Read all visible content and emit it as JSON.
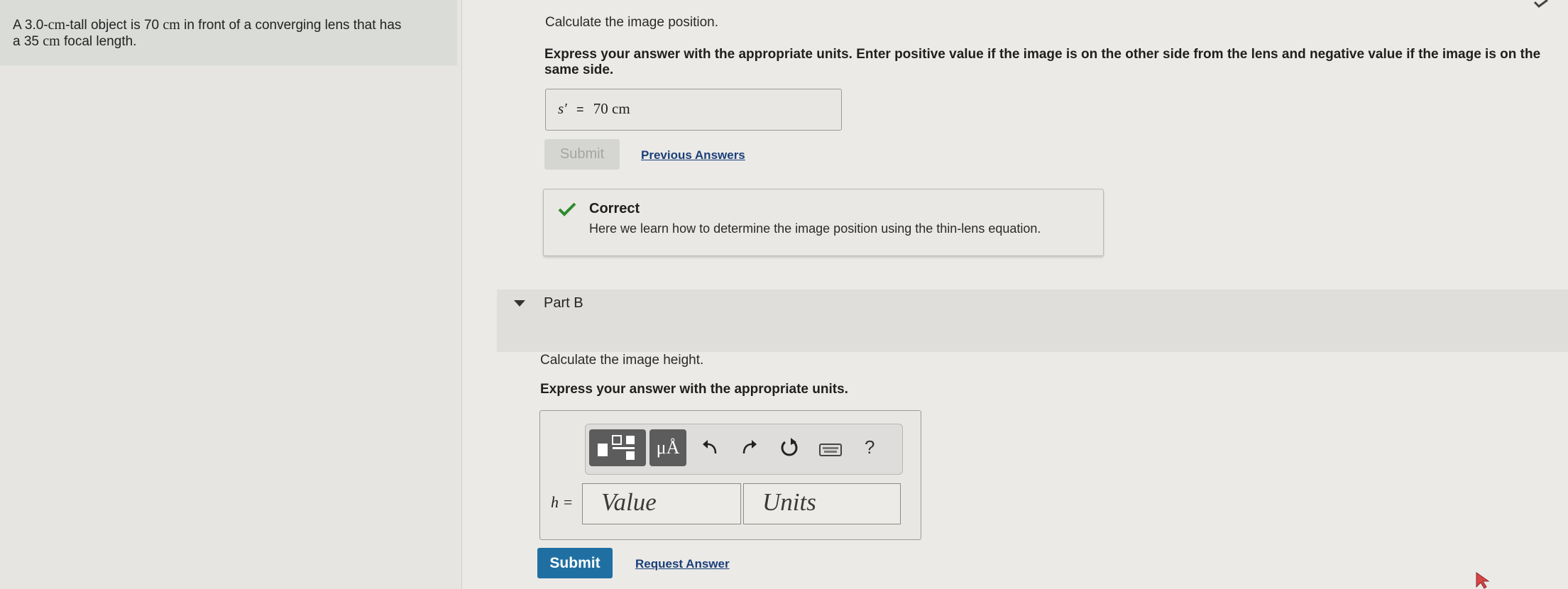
{
  "problem": {
    "line1_a": "A 3.0-",
    "line1_unit1": "cm",
    "line1_b": "-tall object is 70 ",
    "line1_unit2": "cm",
    "line1_c": " in front of a converging lens that has",
    "line2_a": "a 35 ",
    "line2_unit": "cm",
    "line2_b": " focal length."
  },
  "partA": {
    "prompt": "Calculate the image position.",
    "instructions": "Express your answer with the appropriate units. Enter positive value if the image is on the other side from the lens and negative value if the image is on the same side.",
    "answer_var": "s′",
    "answer_eq": "=",
    "answer_value": "70 cm",
    "submit_label": "Submit",
    "previous_answers_label": "Previous Answers",
    "feedback_title": "Correct",
    "feedback_text": "Here we learn how to determine the image position using the thin-lens equation."
  },
  "partB": {
    "title": "Part B",
    "prompt": "Calculate the image height.",
    "instructions": "Express your answer with the appropriate units.",
    "toolbar": {
      "mu_label": "μÅ",
      "help_label": "?"
    },
    "variable_label": "h =",
    "value_placeholder": "Value",
    "units_placeholder": "Units",
    "submit_label": "Submit",
    "request_answer_label": "Request Answer"
  },
  "colors": {
    "accent": "#1f6fa3",
    "correct_green": "#2f8a2f",
    "link": "#1b3f7a"
  }
}
